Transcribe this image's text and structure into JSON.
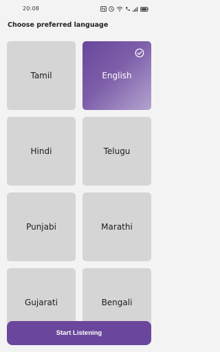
{
  "status_bar": {
    "time": "20:08",
    "icons": [
      "nfc-icon",
      "clock-icon",
      "wifi-icon",
      "call-icon",
      "signal-icon",
      "battery-icon"
    ]
  },
  "screen": {
    "title": "Choose preferred language"
  },
  "languages": [
    {
      "label": "Tamil",
      "selected": false
    },
    {
      "label": "English",
      "selected": true
    },
    {
      "label": "Hindi",
      "selected": false
    },
    {
      "label": "Telugu",
      "selected": false
    },
    {
      "label": "Punjabi",
      "selected": false
    },
    {
      "label": "Marathi",
      "selected": false
    },
    {
      "label": "Gujarati",
      "selected": false
    },
    {
      "label": "Bengali",
      "selected": false
    }
  ],
  "actions": {
    "start_label": "Start Listening"
  },
  "colors": {
    "accent": "#6a479c",
    "card_bg": "#d5d5d5",
    "page_bg": "#f4f3f4"
  }
}
